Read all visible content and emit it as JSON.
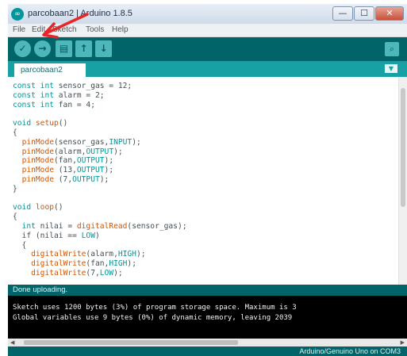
{
  "window": {
    "title": "parcobaan2 | Arduino 1.8.5",
    "minimize": "—",
    "maximize": "☐",
    "close": "✕"
  },
  "menu": [
    "File",
    "Edit",
    "Sketch",
    "Tools",
    "Help"
  ],
  "toolbar": {
    "verify_icon": "check-icon",
    "upload_icon": "arrow-right-icon",
    "new_icon": "new-file-icon",
    "open_icon": "open-icon",
    "save_icon": "save-icon",
    "serial_icon": "serial-monitor-icon"
  },
  "tab": {
    "name": "parcobaan2",
    "menu_glyph": "▼"
  },
  "code": [
    "const int sensor_gas = 12;",
    "const int alarm = 2;",
    "const int fan = 4;",
    "",
    "void setup()",
    "{",
    "  pinMode(sensor_gas,INPUT);",
    "  pinMode(alarm,OUTPUT);",
    "  pinMode(fan,OUTPUT);",
    "  pinMode (13,OUTPUT);",
    "  pinMode (7,OUTPUT);",
    "}",
    "",
    "void loop()",
    "{",
    "  int nilai = digitalRead(sensor_gas);",
    "  if (nilai == LOW)",
    "  {",
    "    digitalWrite(alarm,HIGH);",
    "    digitalWrite(fan,HIGH);",
    "    digitalWrite(7,LOW);"
  ],
  "status": {
    "message": "Done uploading."
  },
  "console": [
    "Sketch uses 1200 bytes (3%) of program storage space. Maximum is 3",
    "Global variables use 9 bytes (0%) of dynamic memory, leaving 2039"
  ],
  "footer": {
    "board": "Arduino/Genuino Uno on COM3"
  },
  "colors": {
    "toolbar": "#006468",
    "tabbar": "#17a1a5",
    "annotation": "#e8262a"
  }
}
